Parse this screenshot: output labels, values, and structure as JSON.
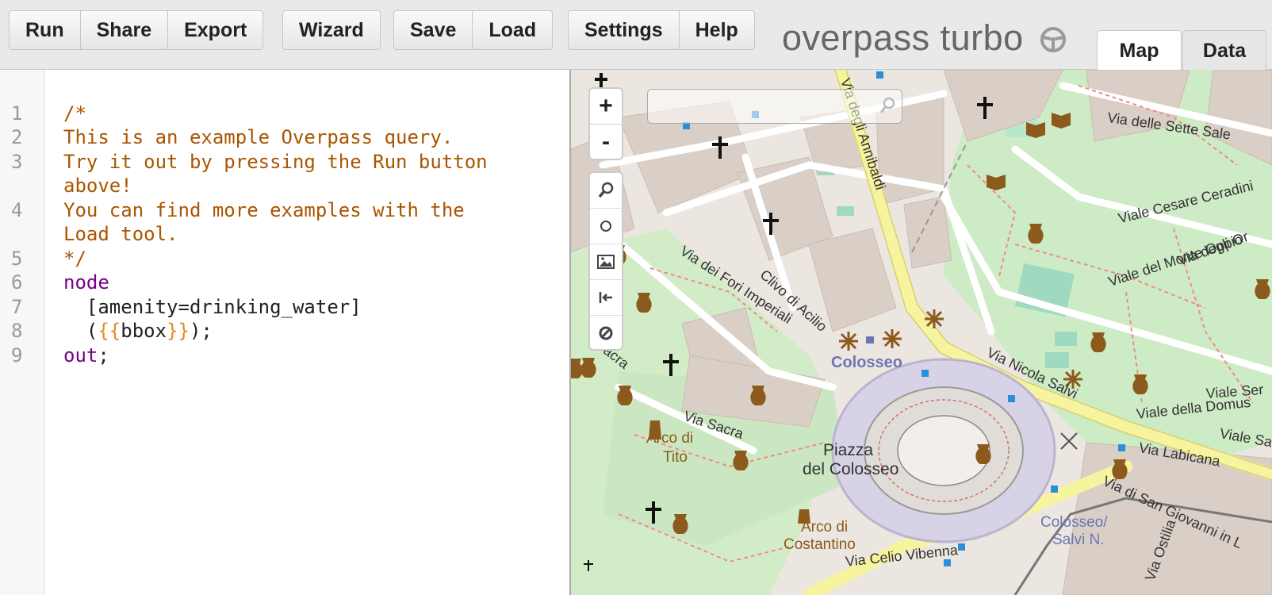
{
  "toolbar": {
    "groups": [
      [
        "Run",
        "Share",
        "Export"
      ],
      [
        "Wizard"
      ],
      [
        "Save",
        "Load"
      ],
      [
        "Settings",
        "Help"
      ]
    ]
  },
  "app": {
    "title": "overpass turbo",
    "logo_icon": "steering-wheel-icon"
  },
  "tabs": {
    "map": "Map",
    "data": "Data",
    "active": "map"
  },
  "editor": {
    "line_numbers": [
      "1",
      "2",
      "3",
      "4",
      "5",
      "6",
      "7",
      "8",
      "9"
    ],
    "lines": {
      "l1": "/*",
      "l2": "This is an example Overpass query.",
      "l3a": "Try it out by pressing the Run button",
      "l3b": "above!",
      "l4a": "You can find more examples with the",
      "l4b": "Load tool.",
      "l5": "*/",
      "l6": "node",
      "l7": "  [amenity=drinking_water]",
      "l8_open": "  (",
      "l8_brace_open": "{{",
      "l8_var": "bbox",
      "l8_brace_close": "}}",
      "l8_close": ");",
      "l9_kw": "out",
      "l9_end": ";"
    }
  },
  "map": {
    "zoom_in": "+",
    "zoom_out": "-",
    "tools": [
      "zoom-to-data-icon",
      "locate-icon",
      "export-image-icon",
      "fit-bounds-icon",
      "clear-icon"
    ],
    "search_placeholder": "",
    "labels": {
      "colosseo": "Colosseo",
      "piazza1": "Piazza",
      "piazza2": "del Colosseo",
      "arco_tito1": "Arco di",
      "arco_tito2": "Tito",
      "arco_cost1": "Arco di",
      "arco_cost2": "Costantino",
      "metro1": "Colosseo/",
      "metro2": "Salvi N."
    },
    "streets": {
      "annibaldi": "Via degli Annibaldi",
      "sette_sale": "Via delle Sette Sale",
      "fori": "Via dei Fori Imperiali",
      "clivo": "Clivo di Acilio",
      "nicola": "Via Nicola Salvi",
      "sacra": "Via Sacra",
      "sacra2": "Sacra",
      "labicana": "Via Labicana",
      "sgiovanni": "Via di San Giovanni in L",
      "celio": "Via Celio Vibenna",
      "ostilia": "Via Ostilia",
      "domus": "Viale della Domus",
      "monte_oppio": "Viale del Monte Oppio",
      "cesare": "Viale Cesare Ceradini",
      "viale_or": "Via degli Or",
      "serv": "Viale Ser",
      "san": "Viale San"
    }
  }
}
